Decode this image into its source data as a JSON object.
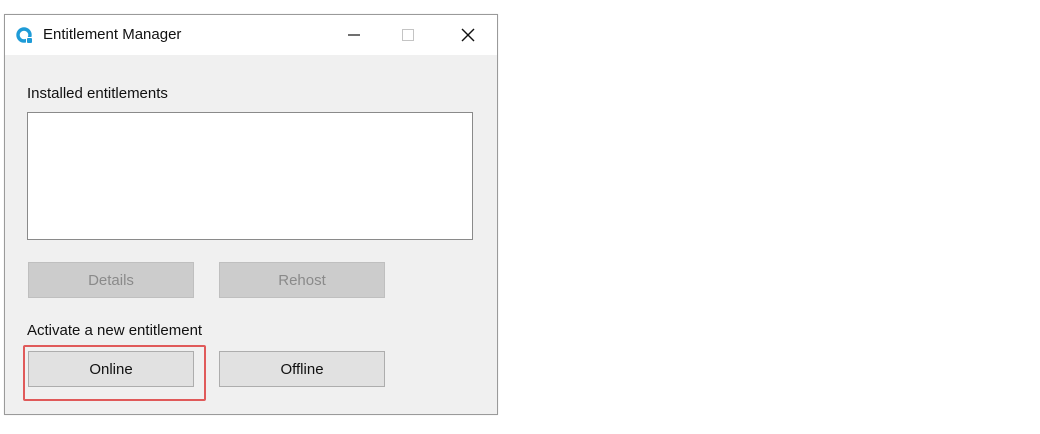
{
  "window": {
    "title": "Entitlement Manager",
    "app_icon": "entitlement-manager-logo-icon",
    "controls": [
      "minimize-icon",
      "maximize-icon",
      "close-icon"
    ]
  },
  "installed": {
    "label": "Installed entitlements",
    "items": [],
    "details_label": "Details",
    "rehost_label": "Rehost",
    "details_enabled": false,
    "rehost_enabled": false
  },
  "activate": {
    "label": "Activate a new entitlement",
    "online_label": "Online",
    "offline_label": "Offline",
    "highlighted": "online"
  },
  "colors": {
    "accent": "#1e9bd7",
    "highlight": "#e05a5a",
    "window_bg": "#f0f0f0"
  }
}
